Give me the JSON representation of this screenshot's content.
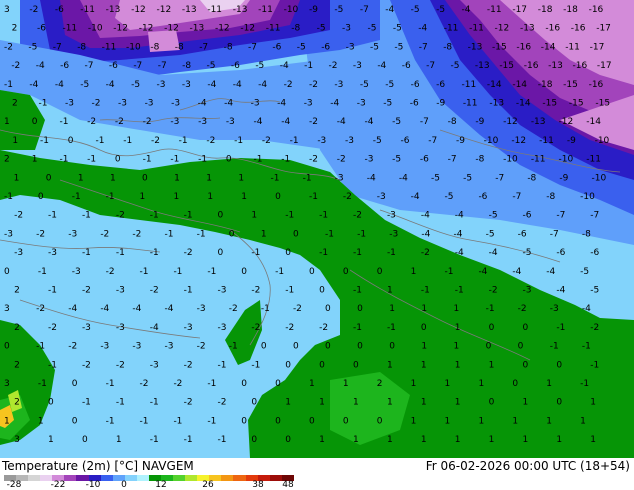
{
  "title": "Temperature (2m) [°C] NAVGEM",
  "date": "Fr 06-02-2026 00:00 UTC (18+54)",
  "colorbar": {
    "colors": [
      "#9a9a9a",
      "#b7b7b7",
      "#d5d5d5",
      "#ead1f0",
      "#d28ad9",
      "#a344ba",
      "#6a16a5",
      "#2a1dc4",
      "#3860f0",
      "#5fa2fb",
      "#84d2fc",
      "#b0f2fe",
      "#069506",
      "#1cb51c",
      "#54d22d",
      "#b0e72e",
      "#f6f22c",
      "#f7c41f",
      "#f39613",
      "#ee6611",
      "#e33a0c",
      "#c51b0b",
      "#9c0d09",
      "#6e0605"
    ],
    "ticks": [
      "-28",
      "-22",
      "-10",
      "0",
      "12",
      "26",
      "38",
      "48"
    ]
  },
  "map_labels": {
    "rows": [
      "3  -2  -6  -11 -13 -12 -12 -13 -11 -13 -11 -10 -9 -5 -7 -4 -5 -5 -4 -11 -17 -18 -18 -16",
      "2  -6  -11 -10 -12 -12 -12 -13 -12 -12 -11 -8 -5 -3 -5 -5 -4 -11 -11 -12 -13 -16 -16 -17",
      "-2  -5  -7  -8  -11 -10 -8 -8 -7 -8 -7 -6 -5 -6 -3 -5 -5 -7 -8 -13 -15 -16 -14 -11 -17",
      "-2  -4  -6  -7  -6  -7  -7 -8 -5 -6 -5 -4 -1 -2 -3 -4 -6 -7 -5 -13 -15 -16 -13 -16 -17",
      "-1  -4  -4  -5  -4  -5  -3 -3 -4 -4 -4 -2 -2 -3 -5 -5 -6 -6 -11 -14 -14 -18 -15 -16",
      "2  -1  -3  -2  -3  -3  -3 -4 -4 -3 -4 -3 -4 -3 -5 -6 -9 -11 -13 -14 -15 -15 -15",
      "1  0  -1  -2  -2  -2  -3 -3 -3 -4 -4 -2 -4 -4 -5 -7 -8 -9 -12 -13 -12 -14",
      "1  -1  0  -1  -1  -2  -1 -2 -1 -2 -1 -3 -3 -5 -6 -7 -9 -10 -12 -11 -9 -10",
      "2  1  -1  -1  0  -1  -1 -1 0 -1 -1 -2 -2 -3 -5 -6 -7 -8 -10 -11 -10 -11",
      "1  0  1  1  0  1  1 1 -1 -1 -3 -4 -4 -5 -5 -7 -8 -9 -10",
      "-1  0  -1  -1  1  1  1 1 0 -1 -2 -3 -4 -5 -6 -7 -8 -10",
      "-2  -1  -1  -2  -1  -1  0  1 -1 -1 -2 -3 -4 -4 -5 -6 -7 -7",
      "-3  -2  -3  -2  -2  -1  -1 0 1 0 -1 -1 -3 -4 -4 -5 -6 -7 -8",
      "-3  -3  -1  -1  -1  -2  0 -1 0 -1 -1 -1 -2 -4 -4 -5 -6 -6",
      "0  -1  -3  -2  -1  -1  -1 0 -1 0 0 0 1 -1 -4 -4 -4 -5",
      "2  -1  -2  -3  -2  -1  -3 -2 -1 0 -1 1 -1 -1 -2 -3 -4 -5",
      "3  -2  -4  -4  -4  -4  -3 -2 -1 -2 0 0 1 1 1 -1 -2 -3 -4",
      "2  -2  -3  -3  -4  -3  -3 -2 -2 -2 -1 -1 0 1 0 0 -1 -2",
      "0  -1  -2  -3  -3  -3  -2 -1 0 0 0 0 0 1 1 0 0 -1 -1",
      "2  -1  -2  -2  -3  -2  -1 -1 0 0 0 1 1 1 1 0 0 -1",
      "3  -1  0  -1  -2  -2  -1 0 0 1 1 2 1 1 1 0 1 -1",
      "2  0  -1  -1  -1  -2  -2 0 1 1 1 1 1 1 0 1 0 1",
      "1  1  0  -1  -1  -1  -1 0 0 0 0 0 1 1 1 1 1 1",
      "3  1  0  1  -1  -1  -1 0 0 1 1 1 1 1 1 1 1 1"
    ]
  }
}
